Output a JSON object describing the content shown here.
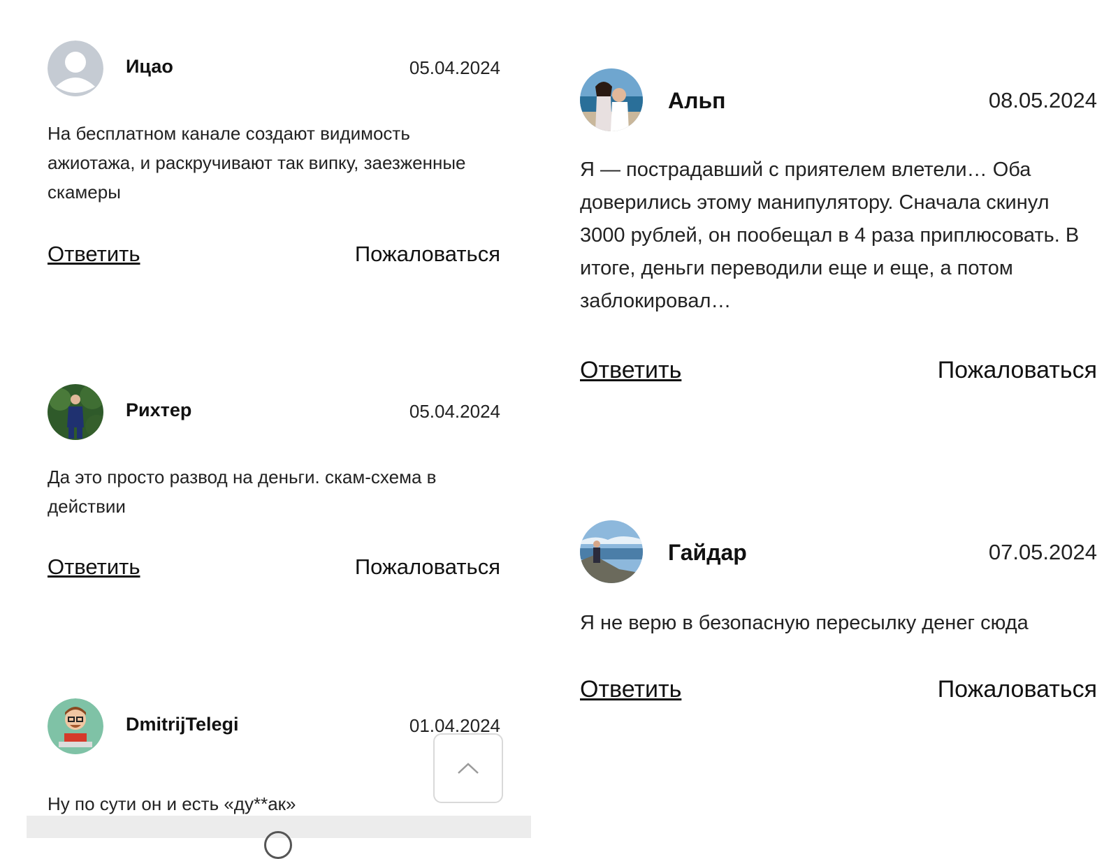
{
  "left_comments": [
    {
      "author": "Ицао",
      "date": "05.04.2024",
      "text": "На бесплатном канале создают видимость ажиотажа, и раскручивают так випку, заезженные скамеры",
      "reply_label": "Ответить",
      "complain_label": "Пожаловаться",
      "avatar": "default-user-icon"
    },
    {
      "author": "Рихтер",
      "date": "05.04.2024",
      "text": "Да это просто развод на деньги. скам-схема в действии",
      "reply_label": "Ответить",
      "complain_label": "Пожаловаться",
      "avatar": "photo-man-suit"
    },
    {
      "author": "DmitrijTelegi",
      "date": "01.04.2024",
      "text": "Ну по сути он и есть «ду**ак»",
      "avatar": "cartoon-man-laptop"
    }
  ],
  "right_comments": [
    {
      "author": "Альп",
      "date": "08.05.2024",
      "text": "Я — пострадавший с приятелем влетели… Оба доверились этому манипулятору. Сначала скинул 3000 рублей, он пообещал в 4 раза приплюсовать. В итоге, деньги переводили еще и еще, а потом заблокировал…",
      "reply_label": "Ответить",
      "complain_label": "Пожаловаться",
      "avatar": "photo-couple-sea"
    },
    {
      "author": "Гайдар",
      "date": "07.05.2024",
      "text": "Я не верю в безопасную пересылку денег сюда",
      "reply_label": "Ответить",
      "complain_label": "Пожаловаться",
      "avatar": "photo-man-mountain"
    }
  ],
  "colors": {
    "accent": "#8b1a8f",
    "avatar_default_bg": "#c5cbd3"
  },
  "scroll_top_icon": "chevron-up-icon"
}
